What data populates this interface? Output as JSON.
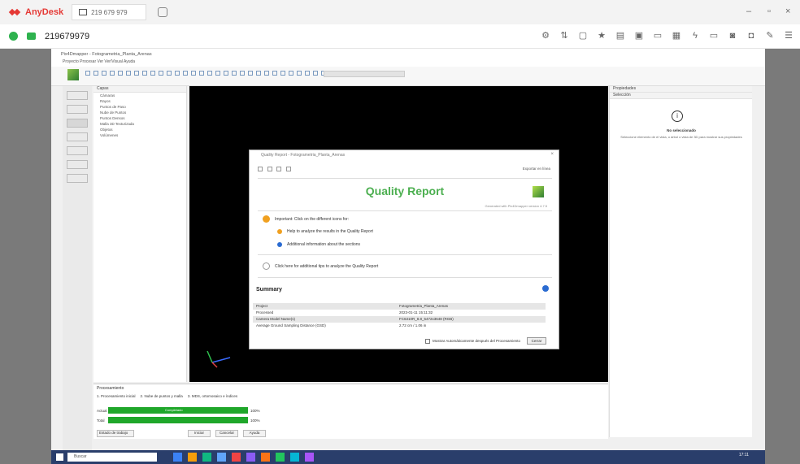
{
  "anydesk": {
    "brand": "AnyDesk",
    "tab_address": "219 679 979",
    "session_id": "219679979"
  },
  "app": {
    "window_title": "Pix4Dmapper - Fotogrametria_Planta_Arenas",
    "menu": "Proyecto   Procesar   Ver   Ver/Visual   Ayuda"
  },
  "dialog": {
    "window_title": "Quality Report - Fotogrametria_Planta_Arenas",
    "toolbar_right": "Exportar en línea",
    "title": "Quality Report",
    "generated": "Generated with Pix4Dmapper version 4.7.5",
    "important": "Important: Click on the different icons for:",
    "tip1": "Help to analyze the results in the Quality Report",
    "tip2": "Additional information about the sections",
    "help_link": "Click here for additional tips to analyze the Quality Report",
    "summary_title": "Summary",
    "summary": [
      {
        "k": "Project",
        "v": "Fotogrametria_Planta_Arenas"
      },
      {
        "k": "Processed",
        "v": "2023-01-11 15:11:32"
      },
      {
        "k": "Camera Model Name(s)",
        "v": "FC6310R_8.8_5472x3648 (RGB)"
      },
      {
        "k": "Average Ground Sampling Distance (GSD)",
        "v": "2.72 cm / 1.06 in"
      }
    ],
    "footer_check": "Mostrar Automáticamente después del Procesamiento",
    "footer_btn": "Cerrar"
  },
  "panel_right": {
    "title": "Propiedades",
    "section": "Selección",
    "empty": "No seleccionado",
    "hint": "Seleccione elemento de el vista, o árbol o vista de 3D para mostrar sus propiedades"
  },
  "layers": {
    "title": "Capas",
    "items": [
      "Cámaras",
      "Rayos",
      "Puntos de Paso",
      "Nube de Puntos",
      "Puntos Densos",
      "Malla 3D Texturizada",
      "Objetos",
      "Volúmenes"
    ]
  },
  "processing": {
    "title": "Procesamiento",
    "step1": "1. Procesamiento inicial",
    "step2": "2. Nube de puntos y malla",
    "step3": "3. MDS, ortomosaico e índices",
    "row1_label": "Actual",
    "row1_state": "Completado",
    "row1_pct": "100%",
    "row1_progress": 1.0,
    "row2_label": "Total",
    "row2_pct": "100%",
    "row2_progress": 1.0,
    "btn_status": "Estado de trabajo",
    "btn_start": "Iniciar",
    "btn_cancel": "Cancelar",
    "btn_help": "Ayuda"
  },
  "taskbar": {
    "search": "Buscar",
    "clock": "17:11"
  },
  "colors": {
    "accent_green": "#4caf50",
    "progress_green": "#1fa72a",
    "anydesk_red": "#e53935",
    "taskbar_blue": "#2a3e6b"
  }
}
